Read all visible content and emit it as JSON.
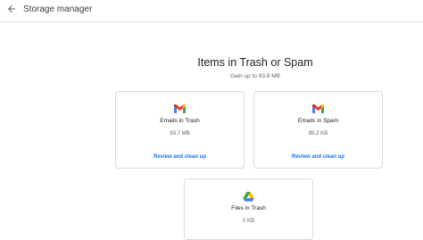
{
  "header": {
    "title": "Storage manager",
    "back_icon": "arrow-left-icon"
  },
  "section": {
    "title": "Items in Trash or Spam",
    "subtitle": "Gain up to 93.8 MB"
  },
  "cards": [
    {
      "icon": "gmail-icon",
      "label": "Emails in Trash",
      "size": "93.7 MB",
      "action": "Review and clean up"
    },
    {
      "icon": "gmail-icon",
      "label": "Emails in Spam",
      "size": "85.2 KB",
      "action": "Review and clean up"
    },
    {
      "icon": "google-drive-icon",
      "label": "Files in Trash",
      "size": "0 KB"
    }
  ],
  "colors": {
    "accent": "#1a73e8",
    "gmail_red": "#ea4335",
    "gmail_blue": "#4285f4",
    "gmail_green": "#34a853",
    "gmail_yellow": "#fbbc04"
  }
}
